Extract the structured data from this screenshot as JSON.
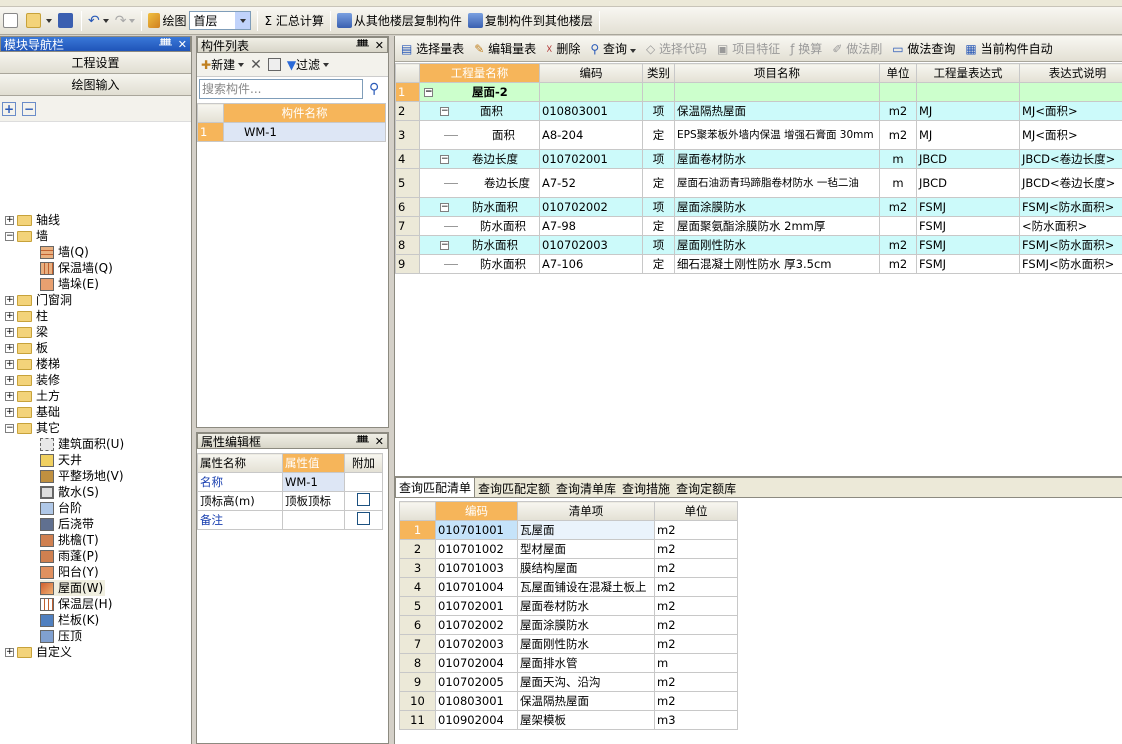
{
  "toolbar": {
    "draw_label": "绘图",
    "floor_value": "首层",
    "sum_label": "Σ 汇总计算",
    "copy_from_label": "从其他楼层复制构件",
    "copy_to_label": "复制构件到其他楼层"
  },
  "nav": {
    "title": "模块导航栏",
    "btn_project": "工程设置",
    "btn_draw": "绘图输入",
    "tree": [
      "轴线",
      "墙",
      "墙(Q)",
      "保温墙(Q)",
      "墙垛(E)",
      "门窗洞",
      "柱",
      "梁",
      "板",
      "楼梯",
      "装修",
      "土方",
      "基础",
      "其它",
      "建筑面积(U)",
      "天井",
      "平整场地(V)",
      "散水(S)",
      "台阶",
      "后浇带",
      "挑檐(T)",
      "雨蓬(P)",
      "阳台(Y)",
      "屋面(W)",
      "保温层(H)",
      "栏板(K)",
      "压顶",
      "自定义"
    ]
  },
  "component_list": {
    "title": "构件列表",
    "new_label": "新建",
    "filter_label": "过滤",
    "search_placeholder": "搜索构件...",
    "col_name": "构件名称",
    "rows": [
      {
        "no": "1",
        "name": "WM-1"
      }
    ]
  },
  "property_editor": {
    "title": "属性编辑框",
    "col_name": "属性名称",
    "col_value": "属性值",
    "col_extra": "附加",
    "rows": [
      {
        "name": "名称",
        "value": "WM-1"
      },
      {
        "name": "顶标高(m)",
        "value": "顶板顶标"
      },
      {
        "name": "备注",
        "value": ""
      }
    ]
  },
  "main_toolbar": {
    "select_list": "选择量表",
    "edit_list": "编辑量表",
    "delete": "删除",
    "query": "查询",
    "select_code": "选择代码",
    "item_feature": "项目特征",
    "convert": "换算",
    "method_brush": "做法刷",
    "method_query": "做法查询",
    "auto": "当前构件自动"
  },
  "main_grid": {
    "headers": [
      "工程量名称",
      "编码",
      "类别",
      "项目名称",
      "单位",
      "工程量表达式",
      "表达式说明"
    ],
    "rows": [
      {
        "no": "1",
        "name": "屋面-2",
        "code": "",
        "type": "",
        "item": "",
        "unit": "",
        "expr": "",
        "desc": ""
      },
      {
        "no": "2",
        "name": "面积",
        "code": "010803001",
        "type": "项",
        "item": "保温隔热屋面",
        "unit": "m2",
        "expr": "MJ",
        "desc": "MJ<面积>"
      },
      {
        "no": "3",
        "name": "面积",
        "code": "A8-204",
        "type": "定",
        "item": "EPS聚苯板外墙内保温 增强石膏面 30mm",
        "unit": "m2",
        "expr": "MJ",
        "desc": "MJ<面积>"
      },
      {
        "no": "4",
        "name": "卷边长度",
        "code": "010702001",
        "type": "项",
        "item": "屋面卷材防水",
        "unit": "m",
        "expr": "JBCD",
        "desc": "JBCD<卷边长度>"
      },
      {
        "no": "5",
        "name": "卷边长度",
        "code": "A7-52",
        "type": "定",
        "item": "屋面石油沥青玛蹄脂卷材防水 一毡二油",
        "unit": "m",
        "expr": "JBCD",
        "desc": "JBCD<卷边长度>"
      },
      {
        "no": "6",
        "name": "防水面积",
        "code": "010702002",
        "type": "项",
        "item": "屋面涂膜防水",
        "unit": "m2",
        "expr": "FSMJ",
        "desc": "FSMJ<防水面积>"
      },
      {
        "no": "7",
        "name": "防水面积",
        "code": "A7-98",
        "type": "定",
        "item": "屋面聚氨酯涂膜防水 2mm厚",
        "unit": "",
        "expr": "FSMJ",
        "desc": "<防水面积>"
      },
      {
        "no": "8",
        "name": "防水面积",
        "code": "010702003",
        "type": "项",
        "item": "屋面刚性防水",
        "unit": "m2",
        "expr": "FSMJ",
        "desc": "FSMJ<防水面积>"
      },
      {
        "no": "9",
        "name": "防水面积",
        "code": "A7-106",
        "type": "定",
        "item": "细石混凝土刚性防水 厚3.5cm",
        "unit": "m2",
        "expr": "FSMJ",
        "desc": "FSMJ<防水面积>"
      }
    ]
  },
  "bottom": {
    "tabs": [
      "查询匹配清单",
      "查询匹配定额",
      "查询清单库",
      "查询措施",
      "查询定额库"
    ],
    "headers": [
      "编码",
      "清单项",
      "单位"
    ],
    "rows": [
      {
        "no": "1",
        "code": "010701001",
        "item": "瓦屋面",
        "unit": "m2"
      },
      {
        "no": "2",
        "code": "010701002",
        "item": "型材屋面",
        "unit": "m2"
      },
      {
        "no": "3",
        "code": "010701003",
        "item": "膜结构屋面",
        "unit": "m2"
      },
      {
        "no": "4",
        "code": "010701004",
        "item": "瓦屋面铺设在混凝土板上",
        "unit": "m2"
      },
      {
        "no": "5",
        "code": "010702001",
        "item": "屋面卷材防水",
        "unit": "m2"
      },
      {
        "no": "6",
        "code": "010702002",
        "item": "屋面涂膜防水",
        "unit": "m2"
      },
      {
        "no": "7",
        "code": "010702003",
        "item": "屋面刚性防水",
        "unit": "m2"
      },
      {
        "no": "8",
        "code": "010702004",
        "item": "屋面排水管",
        "unit": "m"
      },
      {
        "no": "9",
        "code": "010702005",
        "item": "屋面天沟、沿沟",
        "unit": "m2"
      },
      {
        "no": "10",
        "code": "010803001",
        "item": "保温隔热屋面",
        "unit": "m2"
      },
      {
        "no": "11",
        "code": "010902004",
        "item": "屋架模板",
        "unit": "m3"
      }
    ]
  }
}
